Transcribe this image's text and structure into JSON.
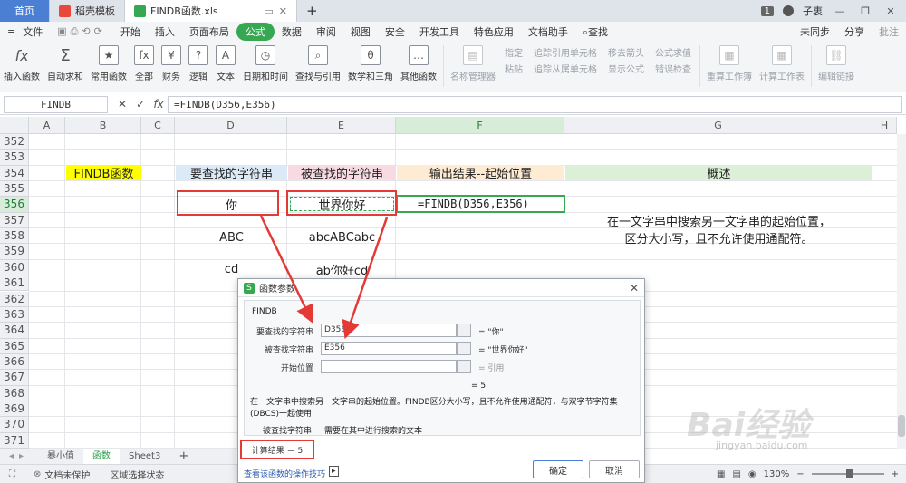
{
  "tabs": {
    "home": "首页",
    "template": "稻壳模板",
    "file": "FINDB函数.xls",
    "new_tab": "+",
    "page_badge": "1",
    "user": "子衷"
  },
  "menu": {
    "file": "文件",
    "items": [
      "开始",
      "插入",
      "页面布局",
      "公式",
      "数据",
      "审阅",
      "视图",
      "安全",
      "开发工具",
      "特色应用",
      "文档助手"
    ],
    "active_index": 3,
    "search": "查找",
    "sync": "未同步",
    "share": "分享",
    "comment": "批注"
  },
  "ribbon": {
    "big_buttons": [
      {
        "label": "插入函数",
        "icon": "fx"
      },
      {
        "label": "自动求和",
        "icon": "Σ"
      },
      {
        "label": "常用函数",
        "icon": "★"
      },
      {
        "label": "全部",
        "icon": "fx"
      },
      {
        "label": "财务",
        "icon": "¥"
      },
      {
        "label": "逻辑",
        "icon": "?"
      },
      {
        "label": "文本",
        "icon": "A"
      },
      {
        "label": "日期和时间",
        "icon": "◷"
      },
      {
        "label": "查找与引用",
        "icon": "⌕"
      },
      {
        "label": "数学和三角",
        "icon": "θ"
      },
      {
        "label": "其他函数",
        "icon": "…"
      }
    ],
    "name_manager": "名称管理器",
    "specify": "指定",
    "paste": "粘贴",
    "trace_precedents": "追踪引用单元格",
    "trace_dependents": "追踪从属单元格",
    "remove_arrows": "移去箭头",
    "show_formulas": "显示公式",
    "formula_eval": "公式求值",
    "error_check": "错误检查",
    "recalc_sheet": "重算工作簿",
    "calc_sheet": "计算工作表",
    "edit_links": "编辑链接"
  },
  "formula_bar": {
    "name_box": "FINDB",
    "cancel": "✕",
    "confirm": "✓",
    "fx": "fx",
    "formula": "=FINDB(D356,E356)"
  },
  "grid": {
    "columns": [
      "A",
      "B",
      "C",
      "D",
      "E",
      "F",
      "G",
      "H"
    ],
    "selected_column": "F",
    "rows": [
      "352",
      "353",
      "354",
      "355",
      "356",
      "357",
      "358",
      "359",
      "360",
      "361",
      "362",
      "363",
      "364",
      "365",
      "366",
      "367",
      "368",
      "369",
      "370",
      "371"
    ],
    "selected_row": "356",
    "b354": "FINDB函数",
    "d354": "要查找的字符串",
    "e354": "被查找的字符串",
    "f354": "输出结果--起始位置",
    "g354": "概述",
    "d356": "你",
    "e356": "世界你好",
    "f356": "=FINDB(D356,E356)",
    "d358": "ABC",
    "e358": "abcABCabc",
    "d360": "cd",
    "e360": "ab你好cd",
    "g357": "在一文字串中搜索另一文字串的起始位置，",
    "g358": "区分大小写，且不允许使用通配符。"
  },
  "sheets": {
    "first": "暴小值",
    "active": "函数",
    "third": "Sheet3",
    "add": "+"
  },
  "status": {
    "protect": "文档未保护",
    "area": "区域选择状态",
    "zoom": "130%"
  },
  "dialog": {
    "title": "函数参数",
    "func": "FINDB",
    "params": [
      {
        "label": "要查找的字符串",
        "value": "D356",
        "result": "= \"你\""
      },
      {
        "label": "被查找字符串",
        "value": "E356",
        "result": "= \"世界你好\""
      },
      {
        "label": "开始位置",
        "value": "",
        "result": "= 引用"
      }
    ],
    "overall_result": "= 5",
    "description": "在一文字串中搜索另一文字串的起始位置。FINDB区分大小写，且不允许使用通配符，与双字节字符集(DBCS)一起使用",
    "param_help_label": "被查找字符串:",
    "param_help_text": "需要在其中进行搜索的文本",
    "calc_result": "计算结果 ＝ 5",
    "tips_link": "查看该函数的操作技巧",
    "ok": "确定",
    "cancel": "取消"
  },
  "watermark": {
    "brand": "Bai经验",
    "url": "jingyan.baidu.com"
  },
  "colors": {
    "accent_green": "#36a852",
    "header_blue": "#dce9f7",
    "header_pink": "#f8dbe2",
    "header_orange": "#fdebd3",
    "header_green": "#dcefd7",
    "yellow": "#ffff00",
    "annotation_red": "#e53935"
  }
}
